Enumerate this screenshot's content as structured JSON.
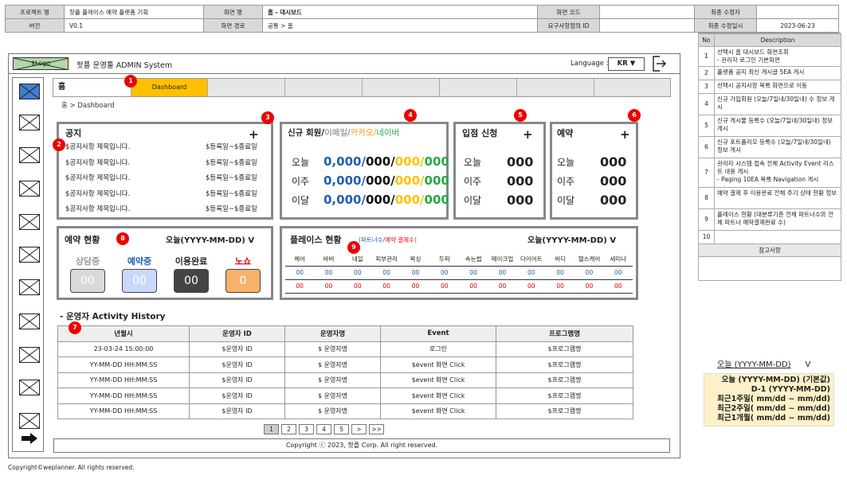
{
  "header": {
    "project_lbl": "프로젝트 명",
    "project": "핫플 플레이스 예약 플랫폼 기획",
    "screen_lbl": "화면 명",
    "screen": "홈 - 대시보드",
    "code_lbl": "화면 코드",
    "code": "",
    "editor_lbl": "최종 수정자",
    "editor": "",
    "version_lbl": "버전",
    "version": "V0.1",
    "path_lbl": "화면 경로",
    "path": "공통 > 홈",
    "req_lbl": "요구사항정의 ID",
    "req": "",
    "date_lbl": "최종 수정일시",
    "date": "2023-06-23"
  },
  "desc_panel": {
    "no_hdr": "No",
    "desc_hdr": "Description",
    "items": [
      {
        "no": "1",
        "text": "선택시 홈 대시보드 화면조회\n- 관리자 로그인 기본화면"
      },
      {
        "no": "2",
        "text": "플랫폼 공지 최신 게시글 5EA 게시"
      },
      {
        "no": "3",
        "text": "선택시 공지사항 목록 화면으로 이동"
      },
      {
        "no": "4",
        "text": "신규 가입회원 (오늘/7일내/30일내) 수 정보 게시"
      },
      {
        "no": "5",
        "text": "신규 게시물 등록수 (오늘/7일내/30일내) 정보 게시"
      },
      {
        "no": "6",
        "text": "신규 포트폴리오 등록수 (오늘/7일내/30일내) 정보 게시"
      },
      {
        "no": "7",
        "text": "관리자 시스템 접속 전체 Activity Event 리스트 내용 게시\n- Paging 10EA 목록 Navigation 게시"
      },
      {
        "no": "8",
        "text": "예약 결제 후 이용완료 전체 주기 상태 현황 정보"
      },
      {
        "no": "9",
        "text": "플레이스 현황 (대분류기준 전체 파트너수와 전체 파트너 예약결제완료 수)"
      },
      {
        "no": "10",
        "text": ""
      }
    ],
    "ref_label": "참고사항"
  },
  "topbar": {
    "logo": "$Logo",
    "title": "핫플 운영툴 ADMIN System",
    "language_label": "Language :",
    "language_value": "KR ▼"
  },
  "tabs": {
    "home": "홈",
    "dashboard": "Dashboard"
  },
  "breadcrumb": "홈 > Dashboard",
  "markers": [
    "1",
    "2",
    "3",
    "4",
    "5",
    "6",
    "7",
    "8",
    "9"
  ],
  "notice": {
    "title": "공지",
    "plus": "+",
    "rows": [
      {
        "title": "$공지사항 제목입니다.",
        "date": "$등록일~$종료일"
      },
      {
        "title": "$공지사항 제목입니다.",
        "date": "$등록일~$종료일"
      },
      {
        "title": "$공지사항 제목입니다.",
        "date": "$등록일~$종료일"
      },
      {
        "title": "$공지사항 제목입니다.",
        "date": "$등록일~$종료일"
      },
      {
        "title": "$공지사항 제목입니다.",
        "date": "$등록일~$종료일"
      }
    ]
  },
  "members": {
    "title_prefix": "신규  회원/",
    "email": "이메일/",
    "kakao": "카카오/",
    "naver": "네이버",
    "rows": [
      {
        "label": "오늘",
        "total": "0,000/",
        "email": "000/",
        "kakao": "000/",
        "naver": "000"
      },
      {
        "label": "이주",
        "total": "0,000/",
        "email": "000/",
        "kakao": "000/",
        "naver": "000"
      },
      {
        "label": "이달",
        "total": "0,000/",
        "email": "000/",
        "kakao": "000/",
        "naver": "000"
      }
    ]
  },
  "entry": {
    "title": "입점 신청",
    "plus": "+",
    "rows": [
      {
        "label": "오늘",
        "value": "000"
      },
      {
        "label": "이주",
        "value": "000"
      },
      {
        "label": "이달",
        "value": "000"
      }
    ]
  },
  "booking": {
    "title": "예약",
    "plus": "+",
    "rows": [
      {
        "label": "오늘",
        "value": "000"
      },
      {
        "label": "이주",
        "value": "000"
      },
      {
        "label": "이달",
        "value": "000"
      }
    ]
  },
  "reservation": {
    "title": "예약 현황",
    "date": "오늘(YYYY-MM-DD)  V",
    "items": [
      {
        "label": "상담중",
        "value": "00"
      },
      {
        "label": "예약중",
        "value": "00"
      },
      {
        "label": "이용완료",
        "value": "00"
      },
      {
        "label": "노쇼",
        "value": "0"
      }
    ]
  },
  "places": {
    "title": "플레이스 현황",
    "sub_a": "(파트너수/",
    "sub_b": "예약 결제수",
    "sub_c": ")",
    "date": "오늘(YYYY-MM-DD)  V",
    "categories": [
      "헤어",
      "바버",
      "네일",
      "피부관리",
      "왁싱",
      "두피",
      "속눈썹",
      "메이크업",
      "다이어트",
      "바디",
      "헬스케어",
      "세미나"
    ],
    "partners": [
      "00",
      "00",
      "00",
      "00",
      "00",
      "00",
      "00",
      "00",
      "00",
      "00",
      "00",
      "00"
    ],
    "payments": [
      "00",
      "00",
      "00",
      "00",
      "00",
      "00",
      "00",
      "00",
      "00",
      "00",
      "00",
      "00"
    ]
  },
  "activity": {
    "title": "- 운영자 Activity History",
    "headers": [
      "년월시",
      "운영자 ID",
      "운영자명",
      "Event",
      "프로그램명"
    ],
    "rows": [
      [
        "23-03-24 15:00:00",
        "$운영자 ID",
        "$ 운영자명",
        "로그인",
        "$프로그램명"
      ],
      [
        "YY-MM-DD HH:MM:SS",
        "$운영자 ID",
        "$ 운영자명",
        "$event 화면 Click",
        "$프로그램명"
      ],
      [
        "YY-MM-DD HH:MM:SS",
        "$운영자 ID",
        "$ 운영자명",
        "$event 화면 Click",
        "$프로그램명"
      ],
      [
        "YY-MM-DD HH:MM:SS",
        "$운영자 ID",
        "$ 운영자명",
        "$event 화면 Click",
        "$프로그램명"
      ],
      [
        "YY-MM-DD HH:MM:SS",
        "$운영자 ID",
        "$ 운영자명",
        "$event 화면 Click",
        "$프로그램명"
      ]
    ],
    "pages": [
      "1",
      "2",
      "3",
      "4",
      "5",
      ">",
      ">>"
    ]
  },
  "copyright": "Copyright ⓒ 2023, 핫플 Corp. All right reserved.",
  "footer": "Copyright©weplanner. All rights reserved.",
  "date_dropdown": {
    "label": "오늘   (YYYY-MM-DD)",
    "arrow": "V",
    "options": [
      "오늘  (YYYY-MM-DD) (기본값)",
      "D-1 (YYYY-MM-DD)",
      "최근1주일( mm/dd ~ mm/dd)",
      "최근2주일( mm/dd ~ mm/dd)",
      "최근1개월( mm/dd ~ mm/dd)"
    ]
  },
  "colors": {
    "blue": "#1f5fb0",
    "orange": "#ffc000",
    "green": "#27a844",
    "red": "#e00000"
  }
}
